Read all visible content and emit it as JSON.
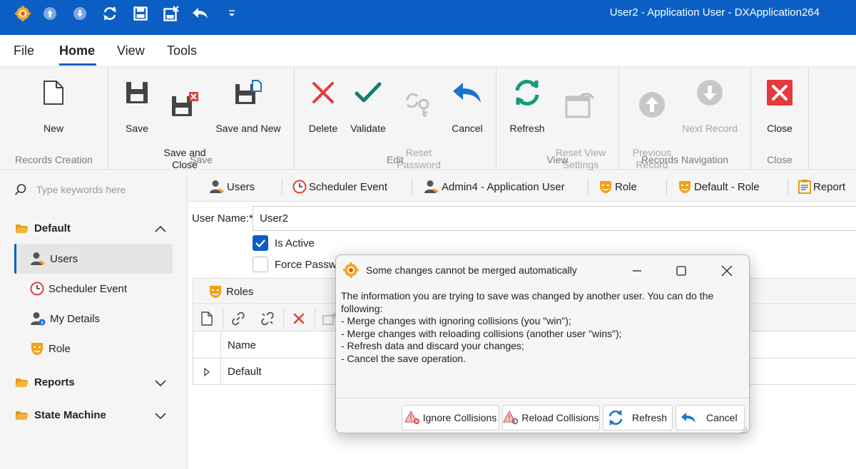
{
  "window": {
    "title": "User2 - Application User - DXApplication264"
  },
  "quick_access": [
    "app-gear-icon",
    "navigate-up-icon",
    "navigate-down-icon",
    "refresh-icon",
    "save-icon",
    "save-and-close-icon",
    "undo-icon",
    "customize-dropdown-icon"
  ],
  "tabs": {
    "file": "File",
    "home": "Home",
    "view": "View",
    "tools": "Tools"
  },
  "ribbon": {
    "new": "New",
    "records_creation": "Records Creation",
    "save": "Save",
    "save_and_close": "Save and\nClose",
    "save_and_new": "Save and New",
    "save_group": "Save",
    "delete": "Delete",
    "validate": "Validate",
    "reset_password": "Reset\nPassword",
    "cancel": "Cancel",
    "edit_group": "Edit",
    "refresh": "Refresh",
    "reset_view_settings": "Reset View\nSettings",
    "view_group": "View",
    "previous_record": "Previous\nRecord",
    "next_record": "Next Record",
    "records_navigation": "Records Navigation",
    "close": "Close",
    "close_group": "Close"
  },
  "sidebar": {
    "search_placeholder": "Type keywords here",
    "default_group": "Default",
    "items": {
      "users": "Users",
      "scheduler_event": "Scheduler Event",
      "my_details": "My Details",
      "role": "Role"
    },
    "reports_group": "Reports",
    "state_machine_group": "State Machine"
  },
  "nav_tabs": {
    "users": "Users",
    "scheduler_event": "Scheduler Event",
    "admin4": "Admin4 - Application User",
    "role": "Role",
    "default_role": "Default - Role",
    "report": "Report"
  },
  "form": {
    "username_label": "User Name:*",
    "username_value": "User2",
    "is_active_label": "Is Active",
    "is_active_checked": true,
    "force_password_label": "Force Passwo",
    "force_password_checked": false
  },
  "roles": {
    "title": "Roles",
    "column_name": "Name",
    "rows": [
      "Default"
    ]
  },
  "dialog": {
    "title": "Some changes cannot be merged automatically",
    "message": "The information you are trying to save was changed by another user. You can do the following:\n- Merge changes with ignoring collisions (you \"win\");\n- Merge changes with reloading collisions (another user \"wins\");\n- Refresh data and discard your changes;\n- Cancel the save operation.",
    "buttons": {
      "ignore": "Ignore Collisions",
      "reload": "Reload Collisions",
      "refresh": "Refresh",
      "cancel": "Cancel"
    }
  },
  "colors": {
    "accent": "#0b5fc4",
    "delete_red": "#e0403a",
    "validate_teal": "#118070",
    "refresh_green": "#159a7a",
    "close_red": "#e5393e",
    "role_orange": "#f2a11a"
  }
}
